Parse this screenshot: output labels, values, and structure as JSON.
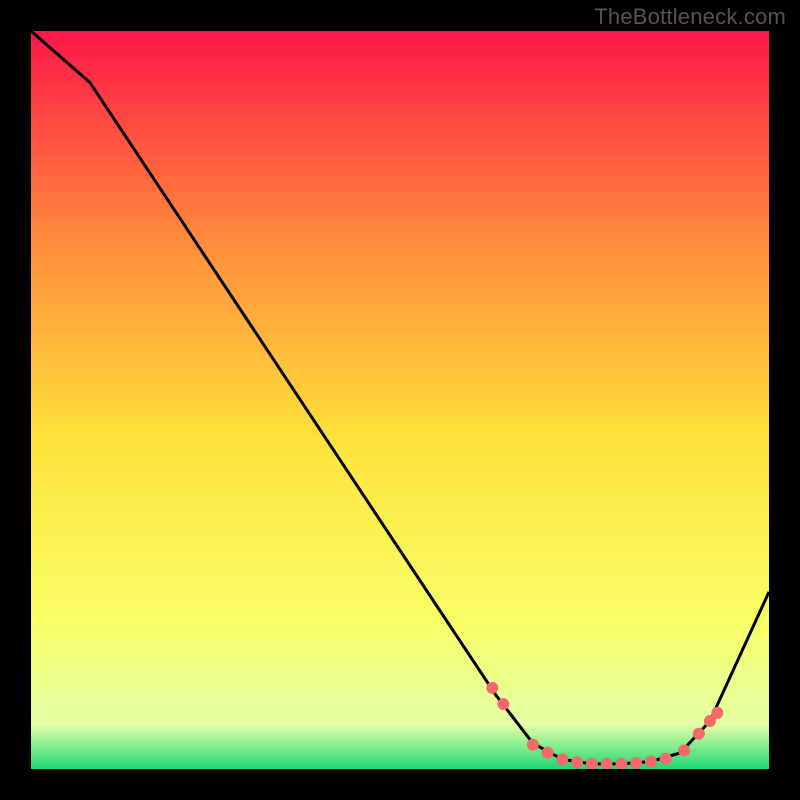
{
  "watermark": "TheBottleneck.com",
  "chart_data": {
    "type": "line",
    "title": "",
    "xlabel": "",
    "ylabel": "",
    "xlim": [
      0,
      100
    ],
    "ylim": [
      0,
      100
    ],
    "grid": false,
    "legend": false,
    "background_gradient": {
      "top_color": "#ff1648",
      "upper_mid_color": "#ff8a3c",
      "mid_color": "#ffe13a",
      "lower_mid_color": "#f7ff66",
      "bottom_color": "#1fd873"
    },
    "series": [
      {
        "name": "bottleneck-curve",
        "color": "#000000",
        "type": "line",
        "x": [
          0,
          8,
          63,
          68,
          72,
          76,
          80,
          84,
          88,
          92,
          100
        ],
        "values": [
          100,
          93,
          10,
          3.5,
          1.3,
          0.7,
          0.7,
          1.0,
          2.2,
          6.5,
          24
        ]
      },
      {
        "name": "recommended-range",
        "color": "#f46a6b",
        "type": "scatter",
        "x": [
          62.5,
          64.0,
          68.0,
          70.0,
          72.0,
          74.0,
          76.0,
          78.0,
          80.0,
          82.0,
          84.0,
          86.0,
          88.5,
          90.5,
          92.0,
          93.0
        ],
        "values": [
          11.0,
          8.8,
          3.3,
          2.2,
          1.3,
          0.9,
          0.7,
          0.7,
          0.7,
          0.8,
          1.0,
          1.4,
          2.5,
          4.8,
          6.5,
          7.6
        ]
      }
    ]
  }
}
